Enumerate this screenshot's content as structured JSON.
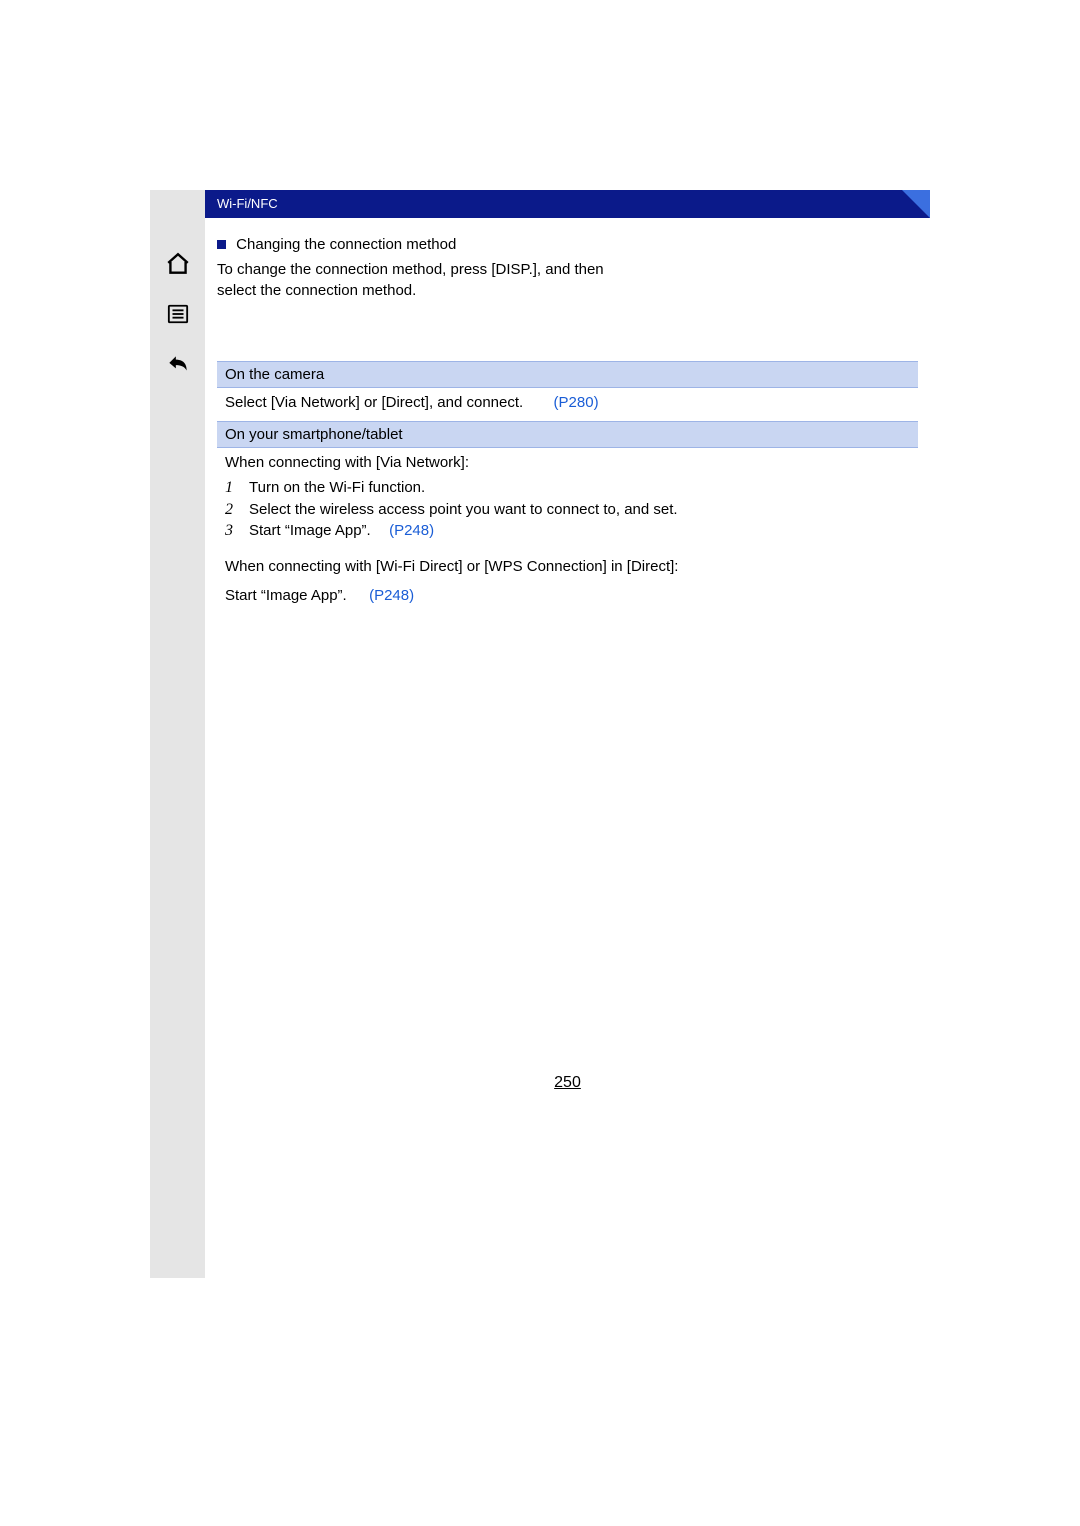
{
  "header": {
    "chapter": "Wi-Fi/NFC"
  },
  "section": {
    "title": "Changing the connection method",
    "description": "To change the connection method, press [DISP.], and then select the connection method."
  },
  "camera": {
    "heading": "On the camera",
    "text": "Select [Via Network] or [Direct], and connect.",
    "link": "(P280)"
  },
  "smartphone": {
    "heading": "On your smartphone/tablet",
    "via_network_label": "When connecting with [Via Network]:",
    "steps": [
      {
        "n": "1",
        "text": "Turn on the Wi-Fi function."
      },
      {
        "n": "2",
        "text": "Select the wireless access point you want to connect to, and set."
      },
      {
        "n": "3",
        "text": "Start “Image App”.",
        "link": "(P248)"
      }
    ],
    "direct_label": "When connecting with [Wi-Fi Direct] or [WPS Connection] in [Direct]:",
    "direct_text": "Start “Image App”.",
    "direct_link": "(P248)"
  },
  "page_number": "250"
}
